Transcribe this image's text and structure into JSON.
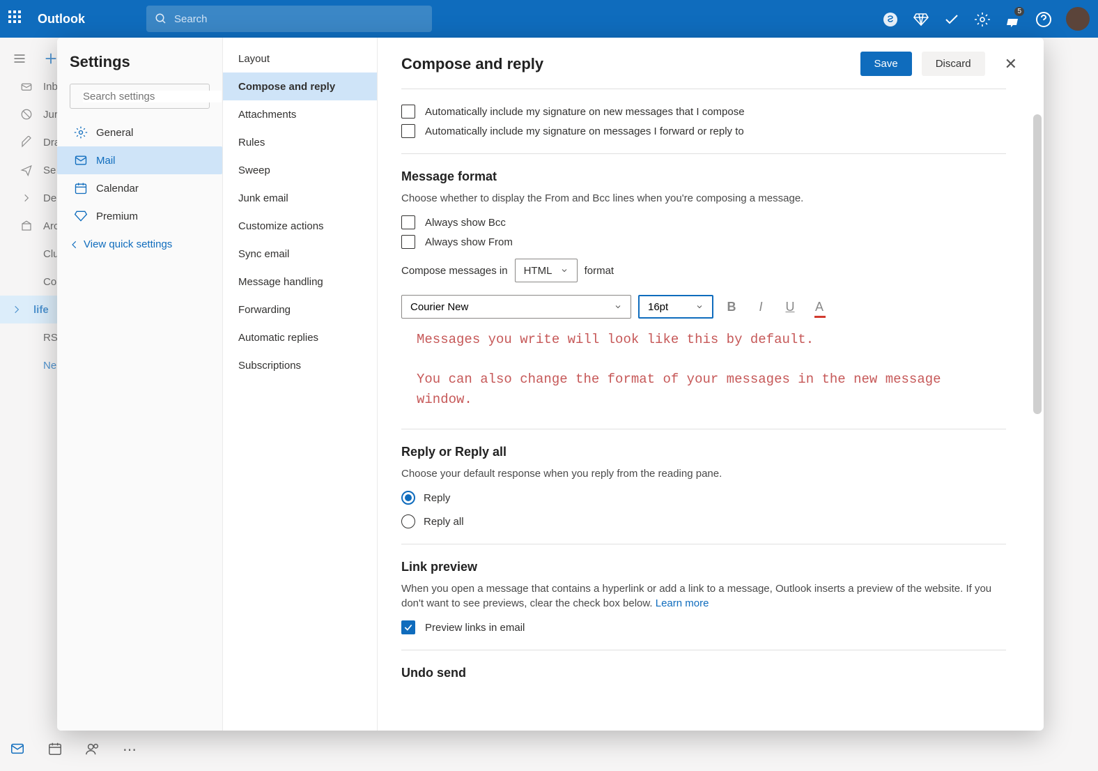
{
  "header": {
    "brand": "Outlook",
    "search_placeholder": "Search",
    "notif_badge": "5"
  },
  "folders": [
    {
      "label": "Inb"
    },
    {
      "label": "Jur"
    },
    {
      "label": "Dra"
    },
    {
      "label": "Se"
    },
    {
      "label": "De"
    },
    {
      "label": "Arc"
    },
    {
      "label": "Clu"
    },
    {
      "label": "Co"
    },
    {
      "label": "life",
      "active": true
    },
    {
      "label": "RS"
    },
    {
      "label": "Ne"
    }
  ],
  "settings": {
    "title": "Settings",
    "search_placeholder": "Search settings",
    "cats": [
      {
        "key": "general",
        "label": "General"
      },
      {
        "key": "mail",
        "label": "Mail",
        "active": true
      },
      {
        "key": "calendar",
        "label": "Calendar"
      },
      {
        "key": "premium",
        "label": "Premium"
      }
    ],
    "view_quick": "View quick settings",
    "subs": [
      "Layout",
      "Compose and reply",
      "Attachments",
      "Rules",
      "Sweep",
      "Junk email",
      "Customize actions",
      "Sync email",
      "Message handling",
      "Forwarding",
      "Automatic replies",
      "Subscriptions"
    ],
    "active_sub": 1
  },
  "pane": {
    "title": "Compose and reply",
    "save": "Save",
    "discard": "Discard",
    "sig_new": "Automatically include my signature on new messages that I compose",
    "sig_reply": "Automatically include my signature on messages I forward or reply to",
    "msgfmt": {
      "title": "Message format",
      "desc": "Choose whether to display the From and Bcc lines when you're composing a message.",
      "bcc": "Always show Bcc",
      "from": "Always show From",
      "compose_pre": "Compose messages in",
      "compose_val": "HTML",
      "compose_post": "format",
      "font": "Courier New",
      "size": "16pt",
      "preview1": "Messages you write will look like this by default.",
      "preview2": "You can also change the format of your messages in the new message window."
    },
    "reply": {
      "title": "Reply or Reply all",
      "desc": "Choose your default response when you reply from the reading pane.",
      "opt1": "Reply",
      "opt2": "Reply all"
    },
    "linkprev": {
      "title": "Link preview",
      "desc": "When you open a message that contains a hyperlink or add a link to a message, Outlook inserts a preview of the website. If you don't want to see previews, clear the check box below. ",
      "learn": "Learn more",
      "chk": "Preview links in email"
    },
    "undo": {
      "title": "Undo send"
    }
  }
}
